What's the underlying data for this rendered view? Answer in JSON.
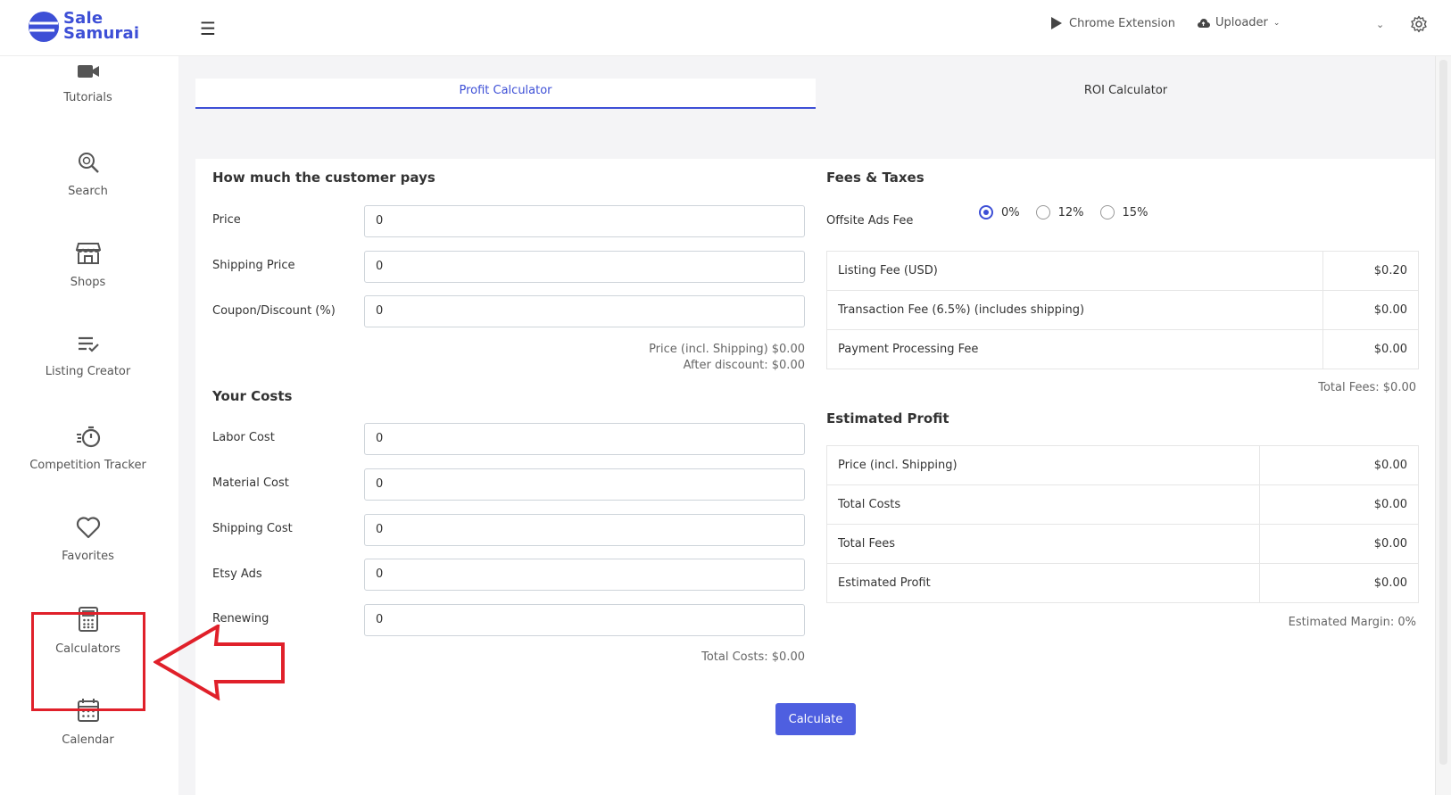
{
  "header": {
    "logo_line1": "Sale",
    "logo_line2": "Samurai",
    "chrome_extension": "Chrome Extension",
    "uploader": "Uploader"
  },
  "sidebar": {
    "items": [
      {
        "label": "Tutorials",
        "icon": "video-camera-icon"
      },
      {
        "label": "Search",
        "icon": "search-icon"
      },
      {
        "label": "Shops",
        "icon": "store-icon"
      },
      {
        "label": "Listing Creator",
        "icon": "list-check-icon"
      },
      {
        "label": "Competition Tracker",
        "icon": "stopwatch-icon"
      },
      {
        "label": "Favorites",
        "icon": "heart-icon"
      },
      {
        "label": "Calculators",
        "icon": "calculator-icon"
      },
      {
        "label": "Calendar",
        "icon": "calendar-icon"
      }
    ]
  },
  "tabs": {
    "profit": "Profit Calculator",
    "roi": "ROI Calculator"
  },
  "customer": {
    "title": "How much the customer pays",
    "fields": [
      {
        "label": "Price",
        "value": "0"
      },
      {
        "label": "Shipping Price",
        "value": "0"
      },
      {
        "label": "Coupon/Discount (%)",
        "value": "0"
      }
    ],
    "price_incl_shipping": "Price (incl. Shipping) $0.00",
    "after_discount": "After discount: $0.00"
  },
  "costs": {
    "title": "Your Costs",
    "fields": [
      {
        "label": "Labor Cost",
        "value": "0"
      },
      {
        "label": "Material Cost",
        "value": "0"
      },
      {
        "label": "Shipping Cost",
        "value": "0"
      },
      {
        "label": "Etsy Ads",
        "value": "0"
      },
      {
        "label": "Renewing",
        "value": "0"
      }
    ],
    "total_costs": "Total Costs: $0.00"
  },
  "fees": {
    "title": "Fees & Taxes",
    "offsite_label": "Offsite Ads Fee",
    "offsite_options": [
      "0%",
      "12%",
      "15%"
    ],
    "offsite_selected": "0%",
    "rows": [
      {
        "label": "Listing Fee (USD)",
        "value": "$0.20"
      },
      {
        "label": "Transaction Fee (6.5%) (includes shipping)",
        "value": "$0.00"
      },
      {
        "label": "Payment Processing Fee",
        "value": "$0.00"
      }
    ],
    "total_fees": "Total Fees: $0.00"
  },
  "profit": {
    "title": "Estimated Profit",
    "rows": [
      {
        "label": "Price (incl. Shipping)",
        "value": "$0.00"
      },
      {
        "label": "Total Costs",
        "value": "$0.00"
      },
      {
        "label": "Total Fees",
        "value": "$0.00"
      },
      {
        "label": "Estimated Profit",
        "value": "$0.00"
      }
    ],
    "margin": "Estimated Margin: 0%"
  },
  "calculate_label": "Calculate",
  "colors": {
    "accent": "#3d4fd6",
    "button": "#4e5fe0",
    "annotation": "#e0202a"
  }
}
